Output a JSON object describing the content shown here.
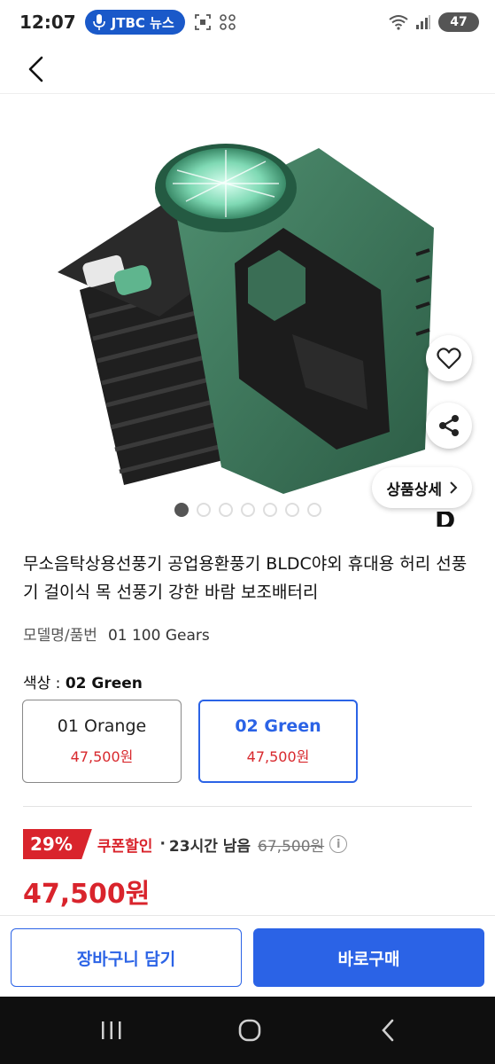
{
  "status_bar": {
    "time": "12:07",
    "news_label": "JTBC 뉴스",
    "battery": "47",
    "colors": {
      "news_bg": "#1a59c9"
    }
  },
  "product": {
    "title": "무소음탁상용선풍기 공업용환풍기 BLDC야외 휴대용 허리 선풍기 걸이식 목 선풍기 강한 바람 보조배터리",
    "model_label": "모델명/품번",
    "model_value": "01 100 Gears",
    "detail_button": "상품상세",
    "image_count": 7,
    "image_active_index": 0,
    "partial_letter": "D"
  },
  "color_select": {
    "label_prefix": "색상 : ",
    "selected": "02 Green",
    "options": [
      {
        "name": "01 Orange",
        "price": "47,500원"
      },
      {
        "name": "02 Green",
        "price": "47,500원"
      }
    ]
  },
  "discount": {
    "percent": "29%",
    "coupon_label": "쿠폰할인",
    "separator": "·",
    "time_left": "23시간 남음",
    "original_price": "67,500원",
    "info_symbol": "i",
    "final_price": "47,500원"
  },
  "actions": {
    "cart": "장바구니 담기",
    "buy": "바로구매"
  },
  "colors": {
    "accent_blue": "#2b63e6",
    "sale_red": "#d9242c"
  }
}
